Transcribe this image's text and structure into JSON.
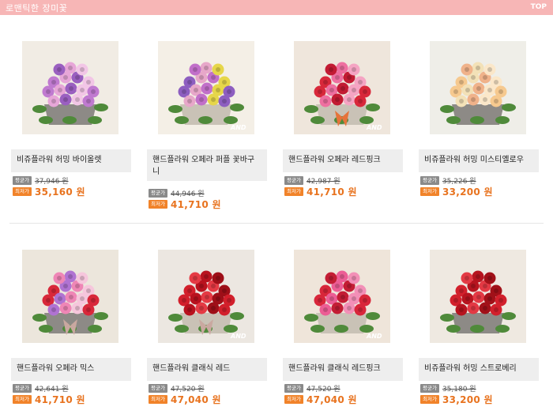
{
  "header": {
    "title": "로맨틱한 장미꽃",
    "top_link": "TOP"
  },
  "labels": {
    "avg": "평균가",
    "low": "최저가"
  },
  "watermark": "AND",
  "products": [
    {
      "name": "비쥬플라워 허밍 바이올렛",
      "old_price": "37,946 원",
      "price": "35,160 원",
      "palette": [
        "#c07ad0",
        "#e7a6d8",
        "#9a5fc0",
        "#f2c6e6"
      ],
      "bg": "#f1ece4"
    },
    {
      "name": "핸드플라워 오페라 퍼플 꽃바구니",
      "old_price": "44,946 원",
      "price": "41,710 원",
      "palette": [
        "#8d5ec0",
        "#e7a7c9",
        "#c16fc9",
        "#e6d64a"
      ],
      "bg": "#f4efe6"
    },
    {
      "name": "핸드플라워 오페라 레드핑크",
      "old_price": "42,987 원",
      "price": "41,710 원",
      "palette": [
        "#d8283a",
        "#ee6fa0",
        "#c21b33",
        "#f5a4c3"
      ],
      "bg": "#efe6dc"
    },
    {
      "name": "비쥬플라워 허밍 미스티옐로우",
      "old_price": "35,226 원",
      "price": "33,200 원",
      "palette": [
        "#f6c98f",
        "#f3e1b7",
        "#f0b28a",
        "#fbe7c9"
      ],
      "bg": "#efeee8"
    },
    {
      "name": "핸드플라워 오페라 믹스",
      "old_price": "42,641 원",
      "price": "41,710 원",
      "palette": [
        "#d8283a",
        "#b073d2",
        "#ef86b6",
        "#f6c6dc"
      ],
      "bg": "#ece6dc"
    },
    {
      "name": "핸드플라워 클래식 레드",
      "old_price": "47,520 원",
      "price": "47,040 원",
      "palette": [
        "#d21f2b",
        "#b8121e",
        "#e53a44",
        "#9e0f18"
      ],
      "bg": "#ece7e1"
    },
    {
      "name": "핸드플라워 클래식 레드핑크",
      "old_price": "47,520 원",
      "price": "47,040 원",
      "palette": [
        "#d8263a",
        "#ec5d95",
        "#c31d34",
        "#f38fb7"
      ],
      "bg": "#efe5da"
    },
    {
      "name": "비쥬플라워 허밍 스트로베리",
      "old_price": "35,180 원",
      "price": "33,200 원",
      "palette": [
        "#d2202c",
        "#b6141f",
        "#e33944",
        "#a11119"
      ],
      "bg": "#efe9e1"
    }
  ]
}
